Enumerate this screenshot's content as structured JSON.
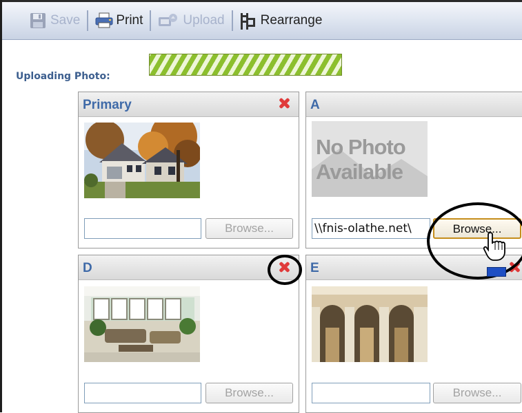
{
  "toolbar": {
    "save_label": "Save",
    "print_label": "Print",
    "upload_label": "Upload",
    "rearrange_label": "Rearrange"
  },
  "upload_status": {
    "label": "Uploading Photo:",
    "progress": "indeterminate"
  },
  "photos": {
    "primary": {
      "title": "Primary",
      "path_value": "",
      "browse_label": "Browse..."
    },
    "a": {
      "title": "A",
      "placeholder_image_text": "No Photo Available",
      "path_value": "\\\\fnis-olathe.net\\",
      "browse_label": "Browse..."
    },
    "d": {
      "title": "D",
      "path_value": "",
      "browse_label": "Browse..."
    },
    "e": {
      "title": "E",
      "path_value": "",
      "browse_label": "Browse..."
    }
  },
  "colors": {
    "toolbar_bg": "#dce3ef",
    "header_title": "#3f6aa8",
    "delete_icon": "#e03a3a",
    "progress": "#8cbf2e",
    "annotation": "#000000"
  }
}
